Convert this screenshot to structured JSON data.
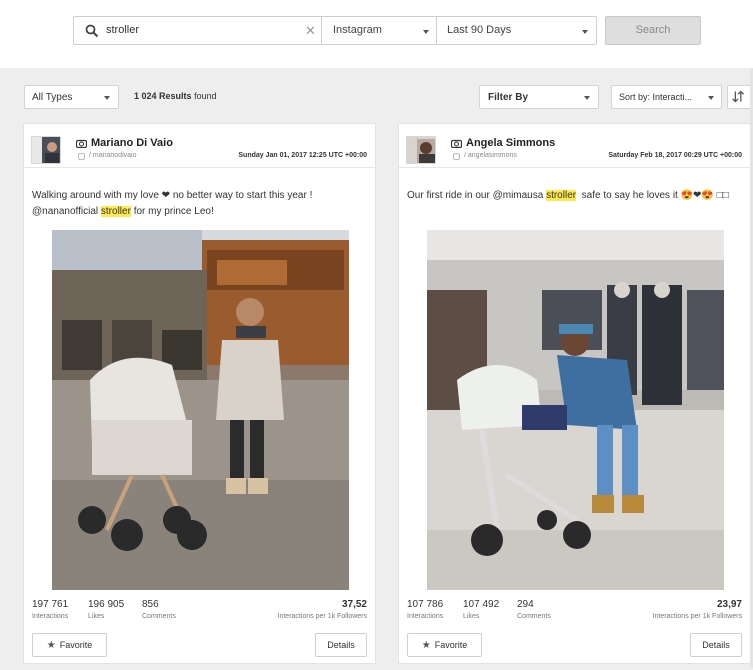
{
  "search": {
    "query": "stroller",
    "network": "Instagram",
    "period": "Last 90 Days",
    "button": "Search"
  },
  "toolbar": {
    "type_filter": "All Types",
    "results_count": "1 024 Results",
    "results_suffix": "found",
    "filter_by": "Filter By",
    "sort_by": "Sort by: Interacti..."
  },
  "posts": [
    {
      "name": "Mariano Di Vaio",
      "handle": "/ marianodivaio",
      "date": "Sunday Jan 01, 2017 12:25 UTC +00:00",
      "caption_before": "Walking around with my love ❤ no better way to start this year ! @nananofficial ",
      "caption_highlight": "stroller",
      "caption_after": " for my prince Leo!",
      "interactions": "197 761",
      "interactions_label": "Interactions",
      "likes": "196 905",
      "likes_label": "Likes",
      "comments": "856",
      "comments_label": "Comments",
      "per_1k": "37,52",
      "per_1k_label": "Interactions per 1k Followers",
      "favorite": "Favorite",
      "details": "Details"
    },
    {
      "name": "Angela Simmons",
      "handle": "/ angelasimmons",
      "date": "Saturday Feb 18, 2017 00:29 UTC +00:00",
      "caption_before": "Our first ride in our @mimausa ",
      "caption_highlight": "stroller",
      "caption_after": "  safe to say he loves it 😍❤😍 □□",
      "interactions": "107 786",
      "interactions_label": "Interactions",
      "likes": "107 492",
      "likes_label": "Likes",
      "comments": "294",
      "comments_label": "Comments",
      "per_1k": "23,97",
      "per_1k_label": "Interactions per 1k Followers",
      "favorite": "Favorite",
      "details": "Details"
    }
  ],
  "icons": {
    "search": "search-icon",
    "clear": "close-icon",
    "camera": "camera-icon",
    "star": "star-icon",
    "sort": "sort-order-icon"
  },
  "colors": {
    "highlight": "#ffe94f",
    "background": "#eeeeee"
  }
}
